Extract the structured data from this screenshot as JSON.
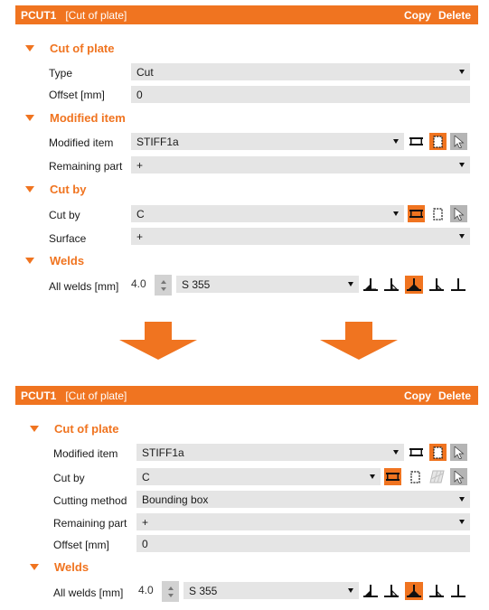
{
  "top": {
    "header": {
      "code": "PCUT1",
      "name": "[Cut of plate]",
      "copy": "Copy",
      "delete": "Delete"
    },
    "sections": {
      "cut_of_plate": "Cut of plate",
      "modified_item": "Modified item",
      "cut_by": "Cut by",
      "welds": "Welds"
    },
    "rows": {
      "type": {
        "label": "Type",
        "value": "Cut"
      },
      "offset": {
        "label": "Offset [mm]",
        "value": "0"
      },
      "modified_item": {
        "label": "Modified item",
        "value": "STIFF1a"
      },
      "remaining_part": {
        "label": "Remaining part",
        "value": "+"
      },
      "cut_by": {
        "label": "Cut by",
        "value": "C"
      },
      "surface": {
        "label": "Surface",
        "value": "+"
      },
      "all_welds": {
        "label": "All welds [mm]",
        "size": "4.0",
        "material": "S 355"
      }
    }
  },
  "bottom": {
    "header": {
      "code": "PCUT1",
      "name": "[Cut of plate]",
      "copy": "Copy",
      "delete": "Delete"
    },
    "sections": {
      "cut_of_plate": "Cut of plate",
      "welds": "Welds"
    },
    "rows": {
      "modified_item": {
        "label": "Modified item",
        "value": "STIFF1a"
      },
      "cut_by": {
        "label": "Cut by",
        "value": "C"
      },
      "cutting_method": {
        "label": "Cutting method",
        "value": "Bounding box"
      },
      "remaining_part": {
        "label": "Remaining part",
        "value": "+"
      },
      "offset": {
        "label": "Offset [mm]",
        "value": "0"
      },
      "all_welds": {
        "label": "All welds [mm]",
        "size": "4.0",
        "material": "S 355"
      }
    }
  },
  "icons": {
    "accent": "#f07420",
    "field_bg": "#e5e5e5",
    "names": [
      "edge-mode-icon",
      "plate-outline-icon",
      "hatched-plate-icon",
      "pointer-icon",
      "weld-type-icon",
      "stepper-icon",
      "dropdown-arrow-icon",
      "down-arrow-icon"
    ]
  }
}
